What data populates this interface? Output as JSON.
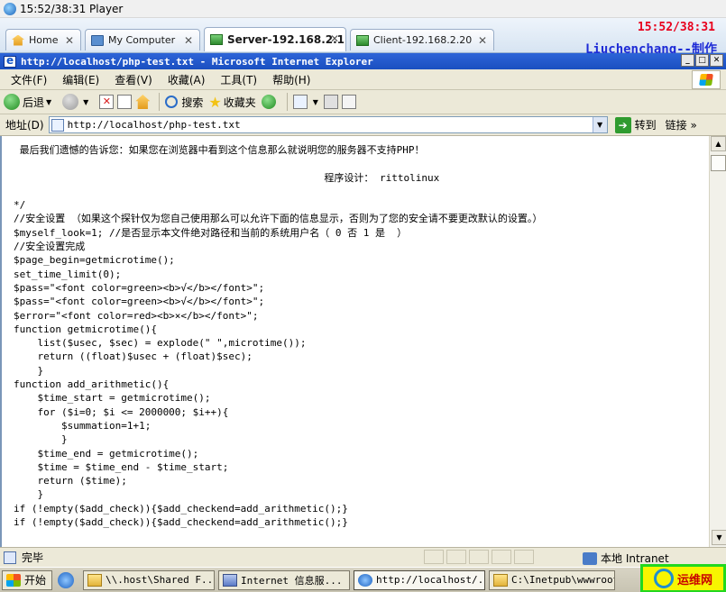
{
  "player": {
    "title": "15:52/38:31 Player"
  },
  "overlay": {
    "time": "15:52/38:31",
    "credit": "Liuchenchang--制作"
  },
  "vm_tabs": [
    {
      "label": "Home",
      "icon": "home-icon",
      "active": false
    },
    {
      "label": "My Computer",
      "icon": "computer-icon",
      "active": false
    },
    {
      "label": "Server-192.168.2.1",
      "icon": "vm-icon",
      "active": true
    },
    {
      "label": "Client-192.168.2.20",
      "icon": "vm-icon",
      "active": false
    }
  ],
  "window": {
    "title": "http://localhost/php-test.txt - Microsoft Internet Explorer"
  },
  "menu": {
    "items": [
      "文件(F)",
      "编辑(E)",
      "查看(V)",
      "收藏(A)",
      "工具(T)",
      "帮助(H)"
    ]
  },
  "toolbar": {
    "back": "后退",
    "search": "搜索",
    "favorites": "收藏夹"
  },
  "address": {
    "label": "地址(D)",
    "url": "http://localhost/php-test.txt",
    "go": "转到",
    "links": "链接"
  },
  "content": {
    "lines": [
      " 最后我们遗憾的告诉您：如果您在浏览器中看到这个信息那么就说明您的服务器不支持PHP！",
      "",
      "                                                    程序设计： rittolinux",
      "",
      "*/",
      "//安全设置 （如果这个探针仅为您自己使用那么可以允许下面的信息显示，否则为了您的安全请不要更改默认的设置。）",
      "$myself_look=1; //是否显示本文件绝对路径和当前的系统用户名（ 0 否 1 是  ）",
      "//安全设置完成",
      "$page_begin=getmicrotime();",
      "set_time_limit(0);",
      "$pass=\"<font color=green><b>√</b></font>\";",
      "$pass=\"<font color=green><b>√</b></font>\";",
      "$error=\"<font color=red><b>×</b></font>\";",
      "function getmicrotime(){",
      "    list($usec, $sec) = explode(\" \",microtime());",
      "    return ((float)$usec + (float)$sec);",
      "    }",
      "function add_arithmetic(){",
      "    $time_start = getmicrotime();",
      "    for ($i=0; $i <= 2000000; $i++){",
      "        $summation=1+1;",
      "        }",
      "    $time_end = getmicrotime();",
      "    $time = $time_end - $time_start;",
      "    return ($time);",
      "    }",
      "if (!empty($add_check)){$add_checkend=add_arithmetic();}",
      "if (!empty($add_check)){$add_checkend=add_arithmetic();}"
    ]
  },
  "status": {
    "text": "完毕",
    "zone": "本地 Intranet"
  },
  "taskbar": {
    "start": "开始",
    "items": [
      {
        "label": "\\\\.host\\Shared F...",
        "icon": "folder-icon",
        "active": false
      },
      {
        "label": "Internet 信息服...",
        "icon": "iis-icon",
        "active": false
      },
      {
        "label": "http://localhost/...",
        "icon": "ie-icon",
        "active": true
      },
      {
        "label": "C:\\Inetpub\\wwwroot",
        "icon": "folder-icon",
        "active": false
      }
    ],
    "badge": "运维网"
  }
}
